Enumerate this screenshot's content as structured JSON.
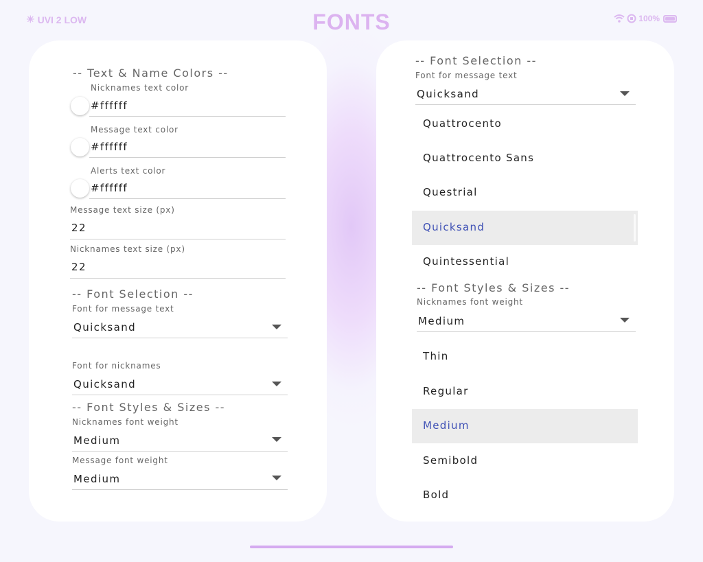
{
  "status": {
    "uv": "UVI 2 LOW",
    "battery": "100%"
  },
  "title": "FONTS",
  "left": {
    "colors_header": "-- Text & Name Colors --",
    "nick_color_label": "Nicknames text color",
    "nick_color_value": "#ffffff",
    "msg_color_label": "Message text color",
    "msg_color_value": "#ffffff",
    "alert_color_label": "Alerts text color",
    "alert_color_value": "#ffffff",
    "msg_size_label": "Message text size (px)",
    "msg_size_value": "22",
    "nick_size_label": "Nicknames text size (px)",
    "nick_size_value": "22",
    "font_header": "-- Font Selection --",
    "msg_font_label": "Font for message text",
    "msg_font_value": "Quicksand",
    "nick_font_label": "Font for nicknames",
    "nick_font_value": "Quicksand",
    "styles_header": "-- Font Styles & Sizes --",
    "nick_weight_label": "Nicknames font weight",
    "nick_weight_value": "Medium",
    "msg_weight_label": "Message font weight",
    "msg_weight_value": "Medium"
  },
  "right": {
    "font_header": "-- Font Selection --",
    "msg_font_label": "Font for message text",
    "msg_font_value": "Quicksand",
    "font_options": [
      "Quattrocento",
      "Quattrocento Sans",
      "Questrial",
      "Quicksand",
      "Quintessential"
    ],
    "font_selected": "Quicksand",
    "styles_header": "-- Font Styles & Sizes --",
    "nick_weight_label": "Nicknames font weight",
    "nick_weight_value": "Medium",
    "weight_options": [
      "Thin",
      "Regular",
      "Medium",
      "Semibold",
      "Bold"
    ],
    "weight_selected": "Medium"
  },
  "colors": {
    "accent": "#3f51b5",
    "title": "#dcb3f0",
    "selected_bg": "#ececec"
  }
}
